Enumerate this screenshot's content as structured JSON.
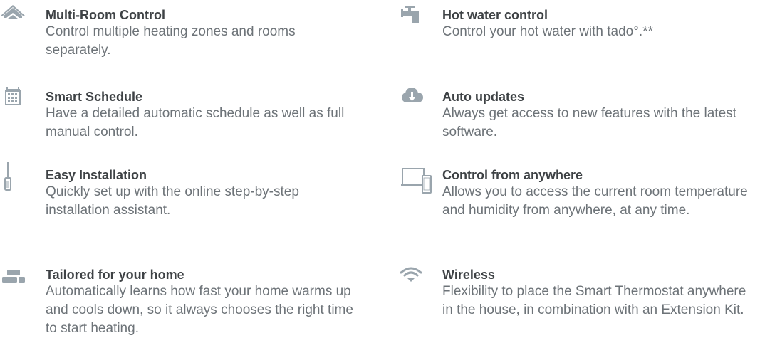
{
  "accent_color": "#9aa5ad",
  "features": {
    "left": [
      {
        "icon": "house-roofs-icon",
        "title": "Multi-Room Control",
        "description": "Control multiple heating zones and rooms separately."
      },
      {
        "icon": "calendar-icon",
        "title": "Smart Schedule",
        "description": "Have a detailed automatic schedule as well as full manual control."
      },
      {
        "icon": "screwdriver-icon",
        "title": "Easy Installation",
        "description": "Quickly set up with the online step-by-step installation assistant."
      },
      {
        "icon": "brick-blocks-icon",
        "title": "Tailored for your home",
        "description": "Automatically learns how fast your home warms up and cools down, so it always chooses the right time to start heating."
      }
    ],
    "right": [
      {
        "icon": "water-tap-icon",
        "title": "Hot water control",
        "description": "Control your hot water with tado°.**"
      },
      {
        "icon": "cloud-download-icon",
        "title": "Auto updates",
        "description": "Always get access to new features with the latest software."
      },
      {
        "icon": "laptop-phone-icon",
        "title": "Control from anywhere",
        "description": "Allows you to access the current room temperature and humidity from anywhere, at any time."
      },
      {
        "icon": "wifi-icon",
        "title": "Wireless",
        "description": "Flexibility to place the Smart Thermostat anywhere in the house, in combination with an Extension Kit."
      }
    ]
  }
}
